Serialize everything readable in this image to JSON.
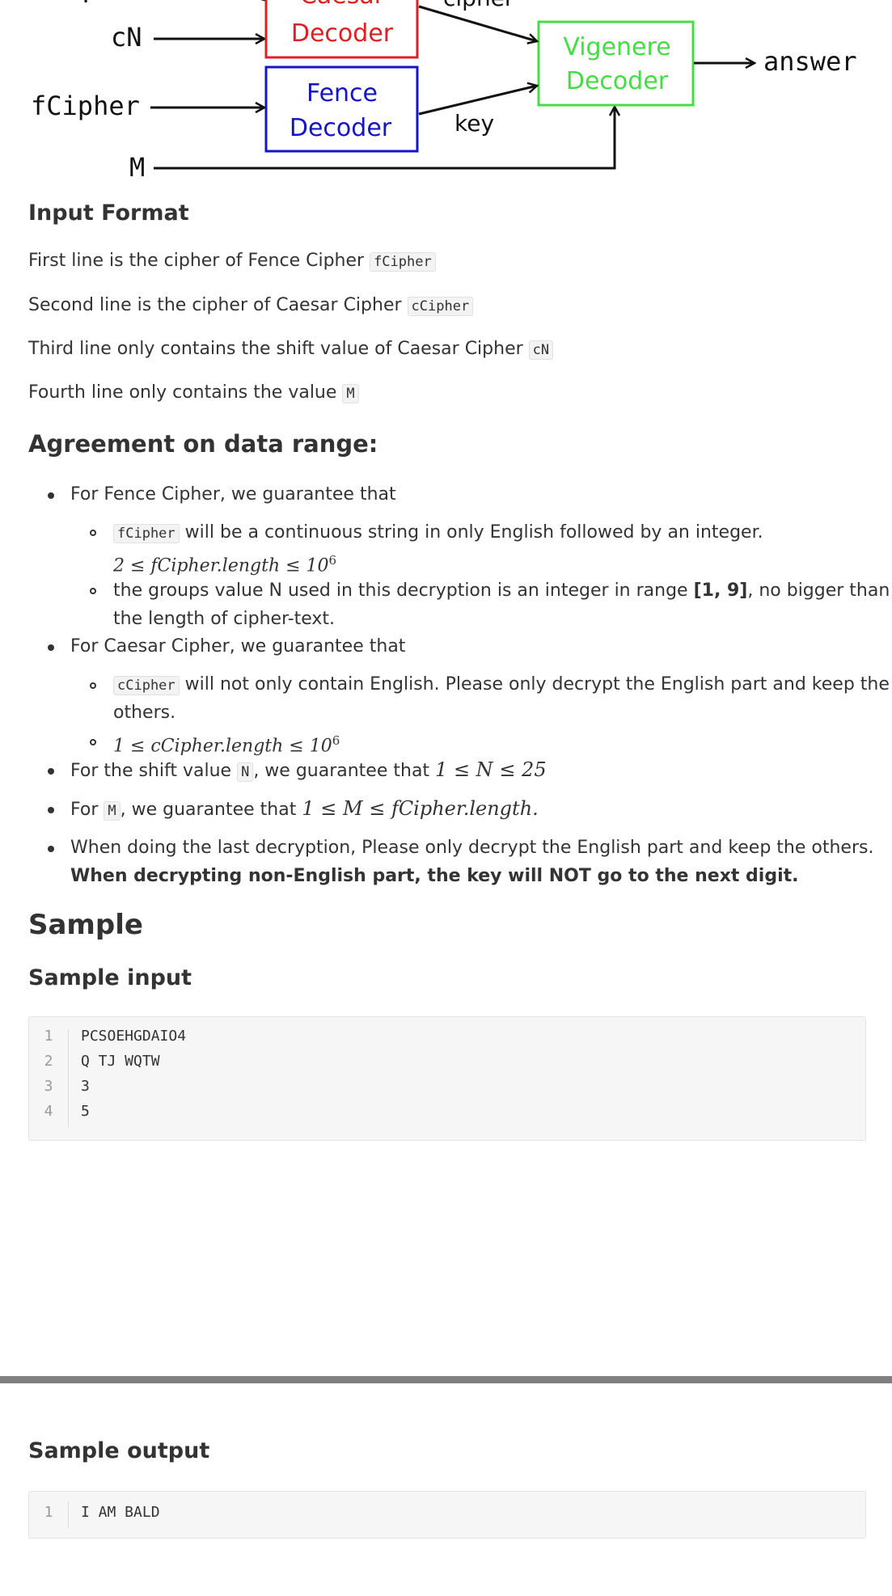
{
  "diagram": {
    "inputs": [
      "cCipher",
      "cN",
      "fCipher",
      "M"
    ],
    "boxes": [
      {
        "line1": "Caesar",
        "line2": "Decoder",
        "color": "#e02020"
      },
      {
        "line1": "Fence",
        "line2": "Decoder",
        "color": "#1515c8"
      },
      {
        "line1": "Vigenere",
        "line2": "Decoder",
        "color": "#44dd44"
      }
    ],
    "edge_labels": [
      "cipher",
      "key"
    ],
    "output": "answer"
  },
  "input_format": {
    "title": "Input Format",
    "lines": [
      {
        "text": "First line is the cipher of Fence Cipher",
        "code": "fCipher"
      },
      {
        "text": "Second line is the cipher of Caesar Cipher",
        "code": "cCipher"
      },
      {
        "text": "Third line only contains the shift value of Caesar Cipher",
        "code": "cN"
      },
      {
        "text": "Fourth line only contains the value",
        "code": "M"
      }
    ]
  },
  "agreement": {
    "title": "Agreement on data range:",
    "fence_intro": "For Fence Cipher, we guarantee that",
    "fence_sub1_code": "fCipher",
    "fence_sub1_text": "will be a continuous string in only English followed by an integer.",
    "fence_sub1_math": "2 ≤ fCipher.length ≤ 10",
    "fence_sub2_a": "the groups value N used in this decryption is an integer in range",
    "fence_sub2_bold": "[1, 9]",
    "fence_sub2_b": ", no bigger than",
    "fence_sub2_c": "the length of cipher-text.",
    "caesar_intro": "For Caesar Cipher, we guarantee that",
    "caesar_sub1_code": "cCipher",
    "caesar_sub1_a": "will not only contain English. Please only decrypt the English part and keep the",
    "caesar_sub1_b": "others.",
    "caesar_sub2_math": "1 ≤ cCipher.length ≤ 10",
    "shift_a": "For the shift value",
    "shift_code": "N",
    "shift_b": ", we guarantee that",
    "shift_math": "1 ≤ N ≤ 25",
    "m_a": "For",
    "m_code": "M",
    "m_b": ", we guarantee that",
    "m_math": "1 ≤ M ≤ fCipher.length.",
    "last_a": "When doing the last decryption,  Please only decrypt the English part and keep the others.",
    "last_bold": "When decrypting non-English part, the key will NOT go to the next digit."
  },
  "sample": {
    "title": "Sample",
    "input_title": "Sample input",
    "input_lines": [
      {
        "n": "1",
        "text": "PCSOEHGDAIO4"
      },
      {
        "n": "2",
        "text": "Q TJ WQTW"
      },
      {
        "n": "3",
        "text": "3"
      },
      {
        "n": "4",
        "text": "5"
      }
    ],
    "output_title": "Sample output",
    "output_lines": [
      {
        "n": "1",
        "text": "I AM BALD"
      }
    ]
  }
}
